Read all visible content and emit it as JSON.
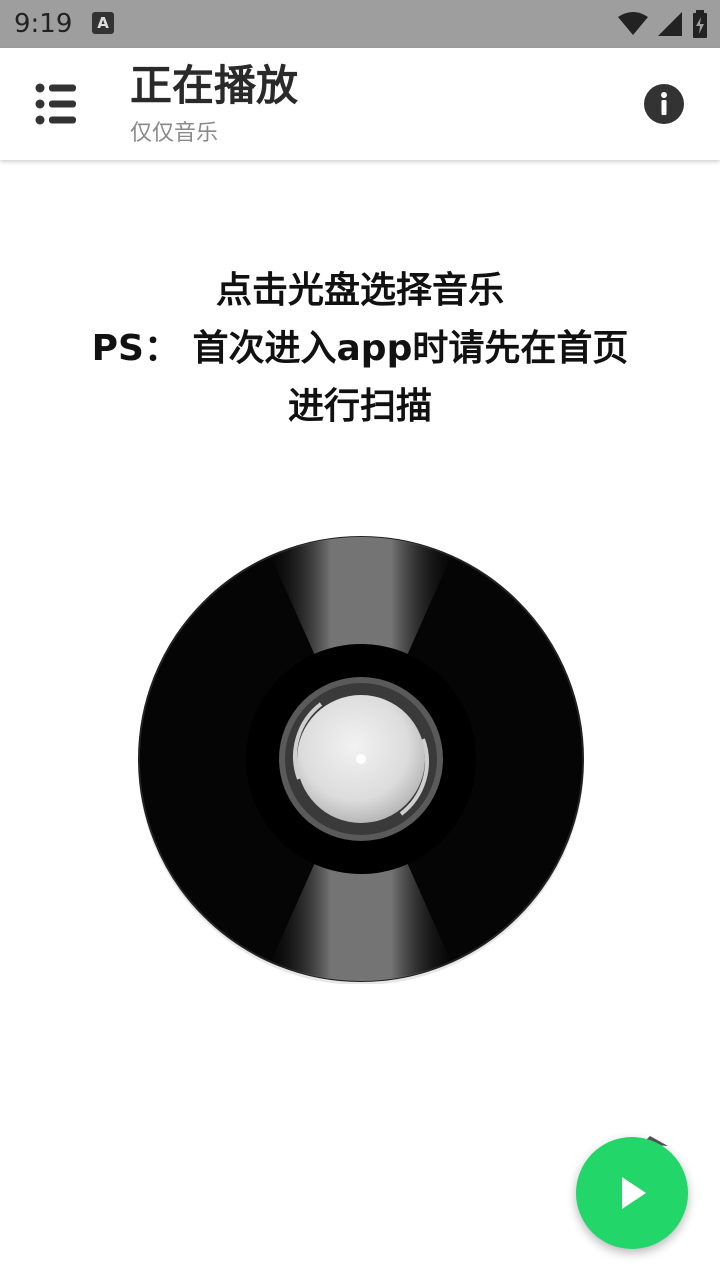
{
  "status_bar": {
    "time": "9:19",
    "notification_icon_letter": "A",
    "icons": [
      "wifi-icon",
      "signal-icon",
      "battery-charging-icon"
    ]
  },
  "app_bar": {
    "title": "正在播放",
    "subtitle": "仅仅音乐",
    "menu_icon": "menu-list-icon",
    "info_icon": "info-icon"
  },
  "instruction": {
    "line1": "点击光盘选择音乐",
    "line2": "PS： 首次进入app时请先在首页",
    "line3": "进行扫描"
  },
  "disc": {
    "icon": "vinyl-disc-icon"
  },
  "fab": {
    "icon": "play-icon",
    "color": "#22d66a"
  },
  "colors": {
    "status_bar": "#9e9e9e",
    "accent": "#22d66a",
    "title": "#2a2a2a",
    "subtitle": "#8a8a8a"
  }
}
